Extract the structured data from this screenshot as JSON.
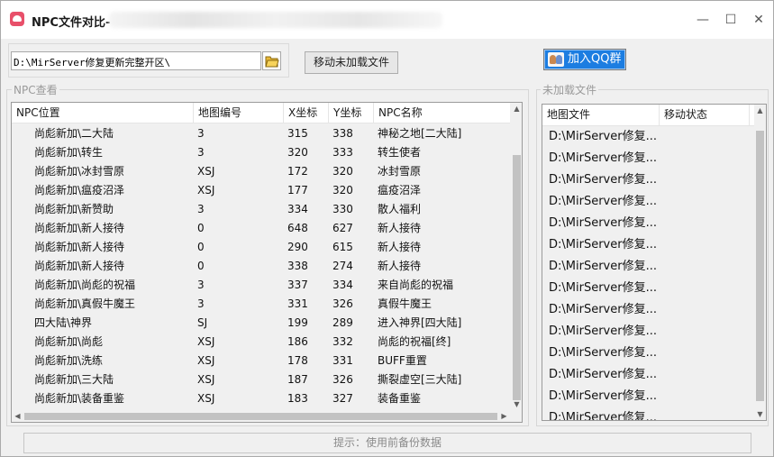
{
  "window": {
    "title": "NPC文件对比-",
    "controls": {
      "minimize": "—",
      "maximize": "☐",
      "close": "✕"
    }
  },
  "toolbar": {
    "path_value": "D:\\MirServer修复更新完整开区\\",
    "folder_icon": "folder-open-icon",
    "move_button": "移动未加载文件",
    "qq_button": "加入QQ群"
  },
  "npc_panel": {
    "label": "NPC查看",
    "columns": [
      "NPC位置",
      "地图编号",
      "X坐标",
      "Y坐标",
      "NPC名称"
    ],
    "rows": [
      [
        "尚彪新加\\二大陆",
        "3",
        "315",
        "338",
        "神秘之地[二大陆]"
      ],
      [
        "尚彪新加\\转生",
        "3",
        "320",
        "333",
        "转生使者"
      ],
      [
        "尚彪新加\\冰封雪原",
        "XSJ",
        "172",
        "320",
        "冰封雪原"
      ],
      [
        "尚彪新加\\瘟疫沼泽",
        "XSJ",
        "177",
        "320",
        "瘟疫沼泽"
      ],
      [
        "尚彪新加\\新赞助",
        "3",
        "334",
        "330",
        "散人福利"
      ],
      [
        "尚彪新加\\新人接待",
        "0",
        "648",
        "627",
        "新人接待"
      ],
      [
        "尚彪新加\\新人接待",
        "0",
        "290",
        "615",
        "新人接待"
      ],
      [
        "尚彪新加\\新人接待",
        "0",
        "338",
        "274",
        "新人接待"
      ],
      [
        "尚彪新加\\尚彪的祝福",
        "3",
        "337",
        "334",
        "来自尚彪的祝福"
      ],
      [
        "尚彪新加\\真假牛魔王",
        "3",
        "331",
        "326",
        "真假牛魔王"
      ],
      [
        "四大陆\\神界",
        "SJ",
        "199",
        "289",
        "进入神界[四大陆]"
      ],
      [
        "尚彪新加\\尚彪",
        "XSJ",
        "186",
        "332",
        "尚彪的祝福[终]"
      ],
      [
        "尚彪新加\\洗练",
        "XSJ",
        "178",
        "331",
        "BUFF重置"
      ],
      [
        "尚彪新加\\三大陆",
        "XSJ",
        "187",
        "326",
        "撕裂虚空[三大陆]"
      ],
      [
        "尚彪新加\\装备重鉴",
        "XSJ",
        "183",
        "327",
        "装备重鉴"
      ]
    ]
  },
  "unloaded_panel": {
    "label": "未加载文件",
    "columns": [
      "地图文件",
      "移动状态"
    ],
    "rows": [
      "D:\\MirServer修复...",
      "D:\\MirServer修复...",
      "D:\\MirServer修复...",
      "D:\\MirServer修复...",
      "D:\\MirServer修复...",
      "D:\\MirServer修复...",
      "D:\\MirServer修复...",
      "D:\\MirServer修复...",
      "D:\\MirServer修复...",
      "D:\\MirServer修复...",
      "D:\\MirServer修复...",
      "D:\\MirServer修复...",
      "D:\\MirServer修复...",
      "D:\\MirServer修复..."
    ]
  },
  "status": {
    "text": "提示：使用前备份数据"
  }
}
